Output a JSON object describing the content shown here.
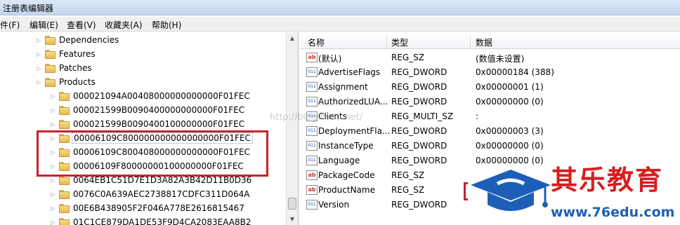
{
  "window": {
    "title": "注册表编辑器"
  },
  "menu": [
    "件(F)",
    "编辑(E)",
    "查看(V)",
    "收藏夹(A)",
    "帮助(H)"
  ],
  "tree": {
    "items": [
      {
        "label": "Dependencies",
        "level": 1,
        "selected": false
      },
      {
        "label": "Features",
        "level": 1,
        "selected": false
      },
      {
        "label": "Patches",
        "level": 1,
        "selected": false
      },
      {
        "label": "Products",
        "level": 1,
        "selected": false
      },
      {
        "label": "000021094A00408000000000000F01FEC",
        "level": 2,
        "selected": false
      },
      {
        "label": "000021599B0090400000000000F01FEC",
        "level": 2,
        "selected": false
      },
      {
        "label": "000021599B0090400100000000F01FEC",
        "level": 2,
        "selected": false
      },
      {
        "label": "00006109C800000000000000000F01FEC",
        "level": 2,
        "selected": true
      },
      {
        "label": "00006109C800408000000000000F01FEC",
        "level": 2,
        "selected": false
      },
      {
        "label": "00006109F80000000100000000F01FEC",
        "level": 2,
        "selected": false
      },
      {
        "label": "0064EB1C51D7E1D3A82A3B42D11B0D36",
        "level": 2,
        "selected": false
      },
      {
        "label": "0076C0A639AEC2738817CDFC311D064A",
        "level": 2,
        "selected": false
      },
      {
        "label": "00E6B438905F2F046A778E2616815467",
        "level": 2,
        "selected": false
      },
      {
        "label": "01C1CE879DA1DE53F9D4CA2083EAA8B2",
        "level": 2,
        "selected": false
      }
    ]
  },
  "list": {
    "headers": {
      "name": "名称",
      "type": "类型",
      "data": "数据"
    },
    "rows": [
      {
        "icon": "string",
        "name": "(默认)",
        "type": "REG_SZ",
        "data": "(数值未设置)"
      },
      {
        "icon": "binary",
        "name": "AdvertiseFlags",
        "type": "REG_DWORD",
        "data": "0x00000184 (388)"
      },
      {
        "icon": "binary",
        "name": "Assignment",
        "type": "REG_DWORD",
        "data": "0x00000001 (1)"
      },
      {
        "icon": "binary",
        "name": "AuthorizedLUA...",
        "type": "REG_DWORD",
        "data": "0x00000000 (0)"
      },
      {
        "icon": "binary",
        "name": "Clients",
        "type": "REG_MULTI_SZ",
        "data": ":"
      },
      {
        "icon": "binary",
        "name": "DeploymentFla...",
        "type": "REG_DWORD",
        "data": "0x00000003 (3)"
      },
      {
        "icon": "binary",
        "name": "InstanceType",
        "type": "REG_DWORD",
        "data": "0x00000000 (0)"
      },
      {
        "icon": "binary",
        "name": "Language",
        "type": "REG_DWORD",
        "data": "0x00000000 (0)"
      },
      {
        "icon": "string",
        "name": "PackageCode",
        "type": "REG_SZ",
        "data": ""
      },
      {
        "icon": "string",
        "name": "ProductName",
        "type": "REG_SZ",
        "data": ""
      },
      {
        "icon": "binary",
        "name": "Version",
        "type": "REG_DWORD",
        "data": ""
      }
    ]
  },
  "watermark": "http://blog.csdn.net/",
  "logo": {
    "brand": "其乐教育",
    "url": "www.76edu.com"
  },
  "colors": {
    "accent_red": "#c8232d",
    "brand_blue": "#1d5fb8",
    "folder": "#f2c65a"
  }
}
